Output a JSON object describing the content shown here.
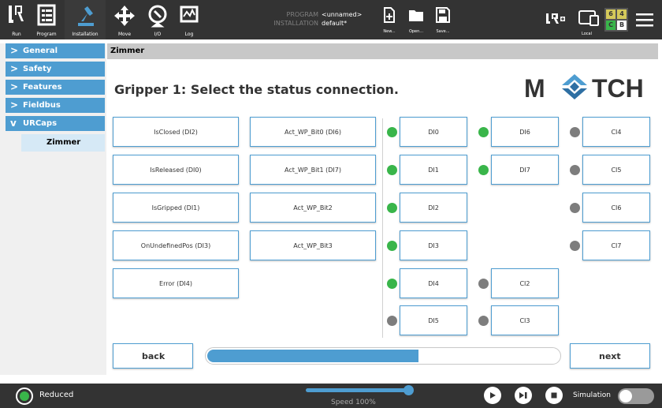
{
  "topbar": {
    "nav": [
      {
        "label": "Run",
        "icon": "ur-logo-icon"
      },
      {
        "label": "Program",
        "icon": "program-icon"
      },
      {
        "label": "Installation",
        "icon": "installation-icon"
      },
      {
        "label": "Move",
        "icon": "move-icon"
      },
      {
        "label": "I/O",
        "icon": "io-icon"
      },
      {
        "label": "Log",
        "icon": "log-icon"
      }
    ],
    "program_key": "PROGRAM",
    "program_value": "<unnamed>",
    "installation_key": "INSTALLATION",
    "installation_value": "default*",
    "file": [
      {
        "label": "New...",
        "icon": "new-file-icon"
      },
      {
        "label": "Open...",
        "icon": "open-folder-icon"
      },
      {
        "label": "Save...",
        "icon": "save-icon"
      }
    ],
    "local_label": "Local",
    "speed_digits": [
      "6",
      "4",
      "C",
      "B"
    ]
  },
  "sidebar": {
    "items": [
      {
        "label": "General",
        "chevron": ">"
      },
      {
        "label": "Safety",
        "chevron": ">"
      },
      {
        "label": "Features",
        "chevron": ">"
      },
      {
        "label": "Fieldbus",
        "chevron": ">"
      },
      {
        "label": "URCaps",
        "chevron": "v"
      }
    ],
    "sub_item": "Zimmer"
  },
  "main": {
    "header": "Zimmer",
    "title": "Gripper 1: Select the status connection.",
    "logo_text": [
      "M",
      "TCH"
    ],
    "signals": [
      "IsClosed (DI2)",
      "IsReleased (DI0)",
      "IsGripped (DI1)",
      "OnUndefinedPos (DI3)",
      "Error (DI4)"
    ],
    "act_signals": [
      "Act_WP_Bit0 (DI6)",
      "Act_WP_Bit1 (DI7)",
      "Act_WP_Bit2",
      "Act_WP_Bit3"
    ],
    "io_col1": [
      {
        "label": "DI0",
        "state": "on"
      },
      {
        "label": "DI1",
        "state": "on"
      },
      {
        "label": "DI2",
        "state": "on"
      },
      {
        "label": "DI3",
        "state": "on"
      },
      {
        "label": "DI4",
        "state": "on"
      },
      {
        "label": "DI5",
        "state": "off"
      }
    ],
    "io_col2": [
      {
        "label": "DI6",
        "state": "on"
      },
      {
        "label": "DI7",
        "state": "on"
      },
      {
        "label": "CI2",
        "state": "off"
      },
      {
        "label": "CI3",
        "state": "off"
      }
    ],
    "io_col3": [
      {
        "label": "CI4",
        "state": "off"
      },
      {
        "label": "CI5",
        "state": "off"
      },
      {
        "label": "CI6",
        "state": "off"
      },
      {
        "label": "CI7",
        "state": "off"
      }
    ],
    "back_label": "back",
    "next_label": "next",
    "progress": 0.6
  },
  "footer": {
    "status_label": "Reduced",
    "speed_label": "Speed 100%",
    "speed": 1.0,
    "simulation_label": "Simulation",
    "simulation_on": false
  },
  "colors": {
    "accent": "#4e9dd1",
    "led_on": "#39b54a",
    "led_off": "#7d7d7d"
  }
}
